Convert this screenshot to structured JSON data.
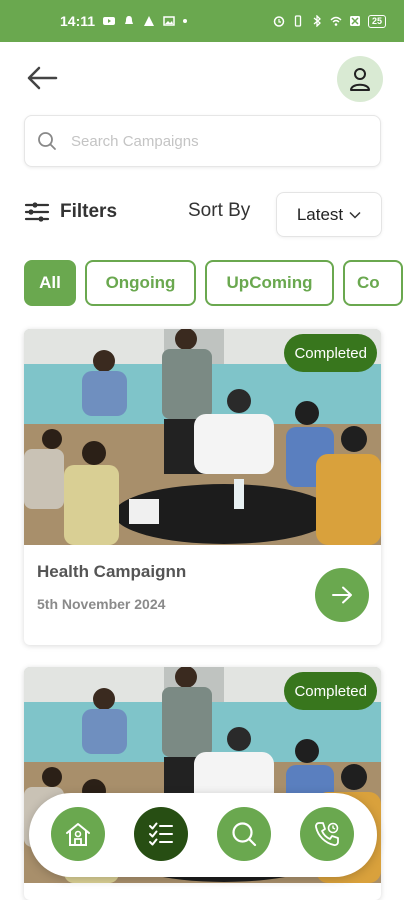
{
  "status_bar": {
    "time": "14:11",
    "battery": "25",
    "background_color": "#6aa84f"
  },
  "header": {
    "back_icon": "arrow-left-icon",
    "profile_icon": "user-icon"
  },
  "search": {
    "placeholder": "Search Campaigns",
    "value": ""
  },
  "filters": {
    "label": "Filters",
    "sort_label": "Sort By",
    "sort_value": "Latest"
  },
  "chips": [
    {
      "label": "All",
      "active": true
    },
    {
      "label": "Ongoing",
      "active": false
    },
    {
      "label": "UpComing",
      "active": false
    },
    {
      "label": "Co",
      "active": false
    }
  ],
  "campaigns": [
    {
      "title": "Health Campaignn",
      "date": "5th November 2024",
      "status": "Completed"
    },
    {
      "title": "",
      "date": "",
      "status": "Completed"
    }
  ],
  "bottom_nav": [
    {
      "icon": "home-icon",
      "active": false
    },
    {
      "icon": "checklist-icon",
      "active": true
    },
    {
      "icon": "search-icon",
      "active": false
    },
    {
      "icon": "phone-call-icon",
      "active": false
    }
  ],
  "colors": {
    "primary": "#6aa84f",
    "dark_green": "#274e13",
    "badge": "#38761d",
    "light_green": "#d9ead3"
  }
}
